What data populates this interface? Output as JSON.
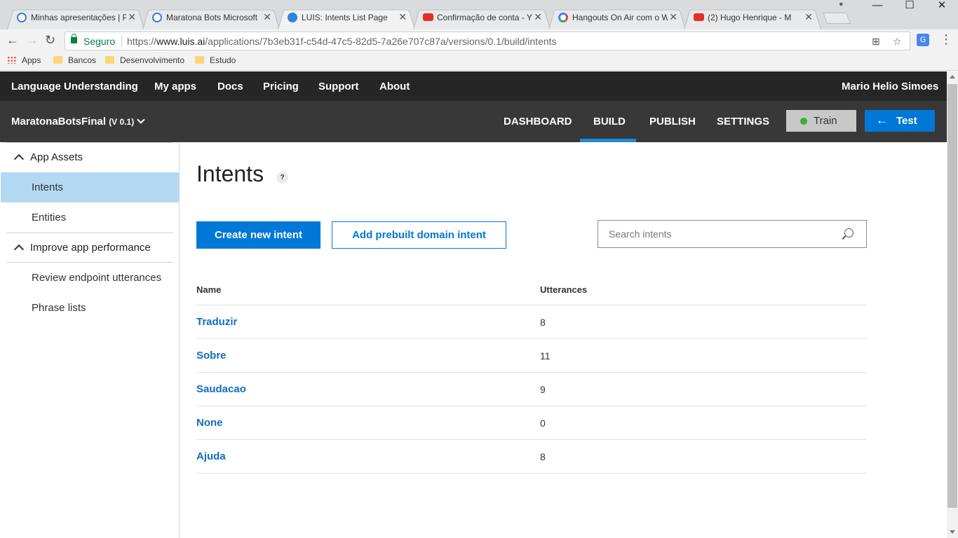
{
  "browser": {
    "tabs": [
      {
        "title": "Minhas apresentações | P",
        "icon": "globe-icon"
      },
      {
        "title": "Maratona Bots Microsoft",
        "icon": "globe-icon"
      },
      {
        "title": "LUIS: Intents List Page",
        "icon": "luis-icon",
        "active": true
      },
      {
        "title": "Confirmação de conta - Y",
        "icon": "youtube-icon"
      },
      {
        "title": "Hangouts On Air com o W",
        "icon": "google-icon"
      },
      {
        "title": "(2) Hugo Henrique - M",
        "icon": "youtube-icon"
      }
    ],
    "secure_label": "Seguro",
    "url_prefix": "https://",
    "url_host": "www.luis.ai",
    "url_path": "/applications/7b3eb31f-c54d-47c5-82d5-7a26e707c87a/versions/0.1/build/intents",
    "bookmarks": [
      "Apps",
      "Bancos",
      "Desenvolvimento",
      "Estudo"
    ]
  },
  "topnav": {
    "brand": "Language Understanding",
    "items": [
      "My apps",
      "Docs",
      "Pricing",
      "Support",
      "About"
    ],
    "user": "Mario Helio Simoes"
  },
  "appbar": {
    "app_name": "MaratonaBotsFinal",
    "version": "(V 0.1)",
    "tabs": [
      "DASHBOARD",
      "BUILD",
      "PUBLISH",
      "SETTINGS"
    ],
    "active_tab": "BUILD",
    "train_label": "Train",
    "test_label": "Test",
    "accent": "#0078d7"
  },
  "sidebar": {
    "section1": "App Assets",
    "section1_items": [
      "Intents",
      "Entities"
    ],
    "selected": "Intents",
    "section2": "Improve app performance",
    "section2_items": [
      "Review endpoint utterances",
      "Phrase lists"
    ]
  },
  "main": {
    "title": "Intents",
    "help": "?",
    "create_label": "Create new intent",
    "prebuilt_label": "Add prebuilt domain intent",
    "search_placeholder": "Search intents",
    "columns": [
      "Name",
      "Utterances"
    ],
    "rows": [
      {
        "name": "Traduzir",
        "utterances": "8"
      },
      {
        "name": "Sobre",
        "utterances": "11"
      },
      {
        "name": "Saudacao",
        "utterances": "9"
      },
      {
        "name": "None",
        "utterances": "0"
      },
      {
        "name": "Ajuda",
        "utterances": "8"
      }
    ]
  }
}
